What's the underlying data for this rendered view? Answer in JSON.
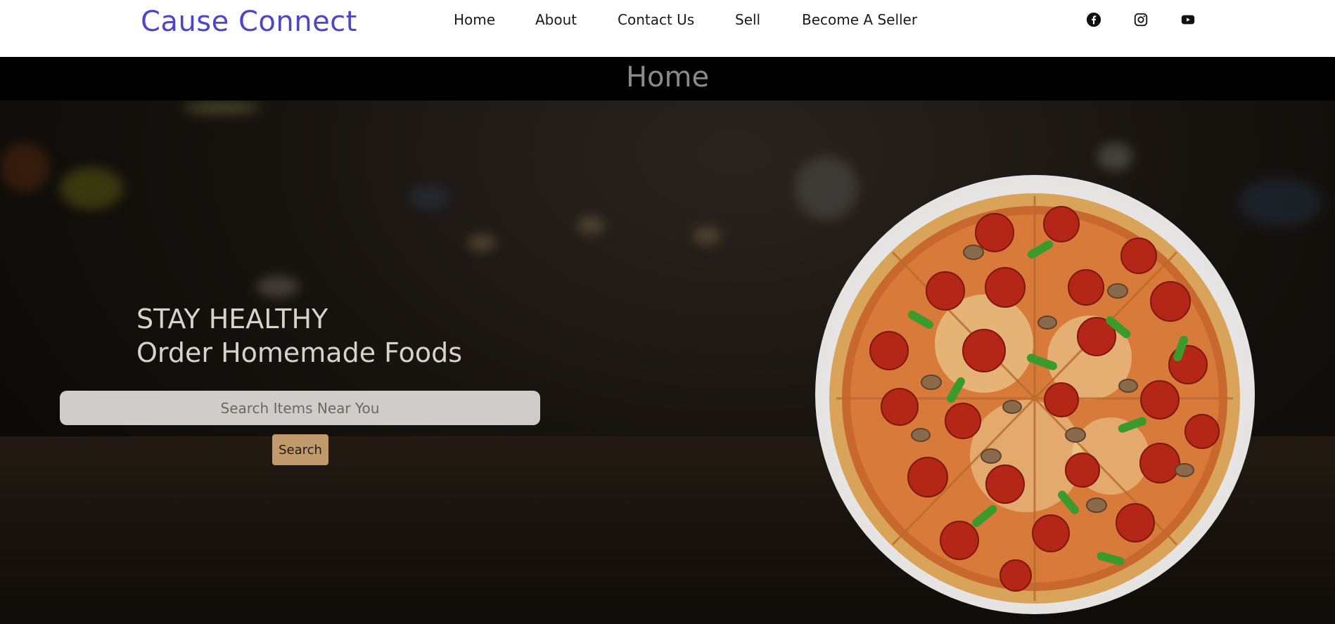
{
  "brand": {
    "name": "Cause Connect"
  },
  "nav": {
    "items": [
      {
        "label": "Home"
      },
      {
        "label": "About"
      },
      {
        "label": "Contact Us"
      },
      {
        "label": "Sell"
      },
      {
        "label": "Become A Seller"
      }
    ]
  },
  "social": {
    "icons": [
      "facebook-icon",
      "instagram-icon",
      "youtube-icon"
    ]
  },
  "page": {
    "title": "Home"
  },
  "hero": {
    "line1": "STAY HEALTHY",
    "line2": "Order Homemade Foods",
    "search": {
      "placeholder": "Search Items Near You",
      "value": ""
    },
    "search_button": "Search"
  },
  "colors": {
    "brand": "#4b45cc",
    "accent_button": "#c19a6b",
    "navbar_bg": "#ffffff"
  }
}
